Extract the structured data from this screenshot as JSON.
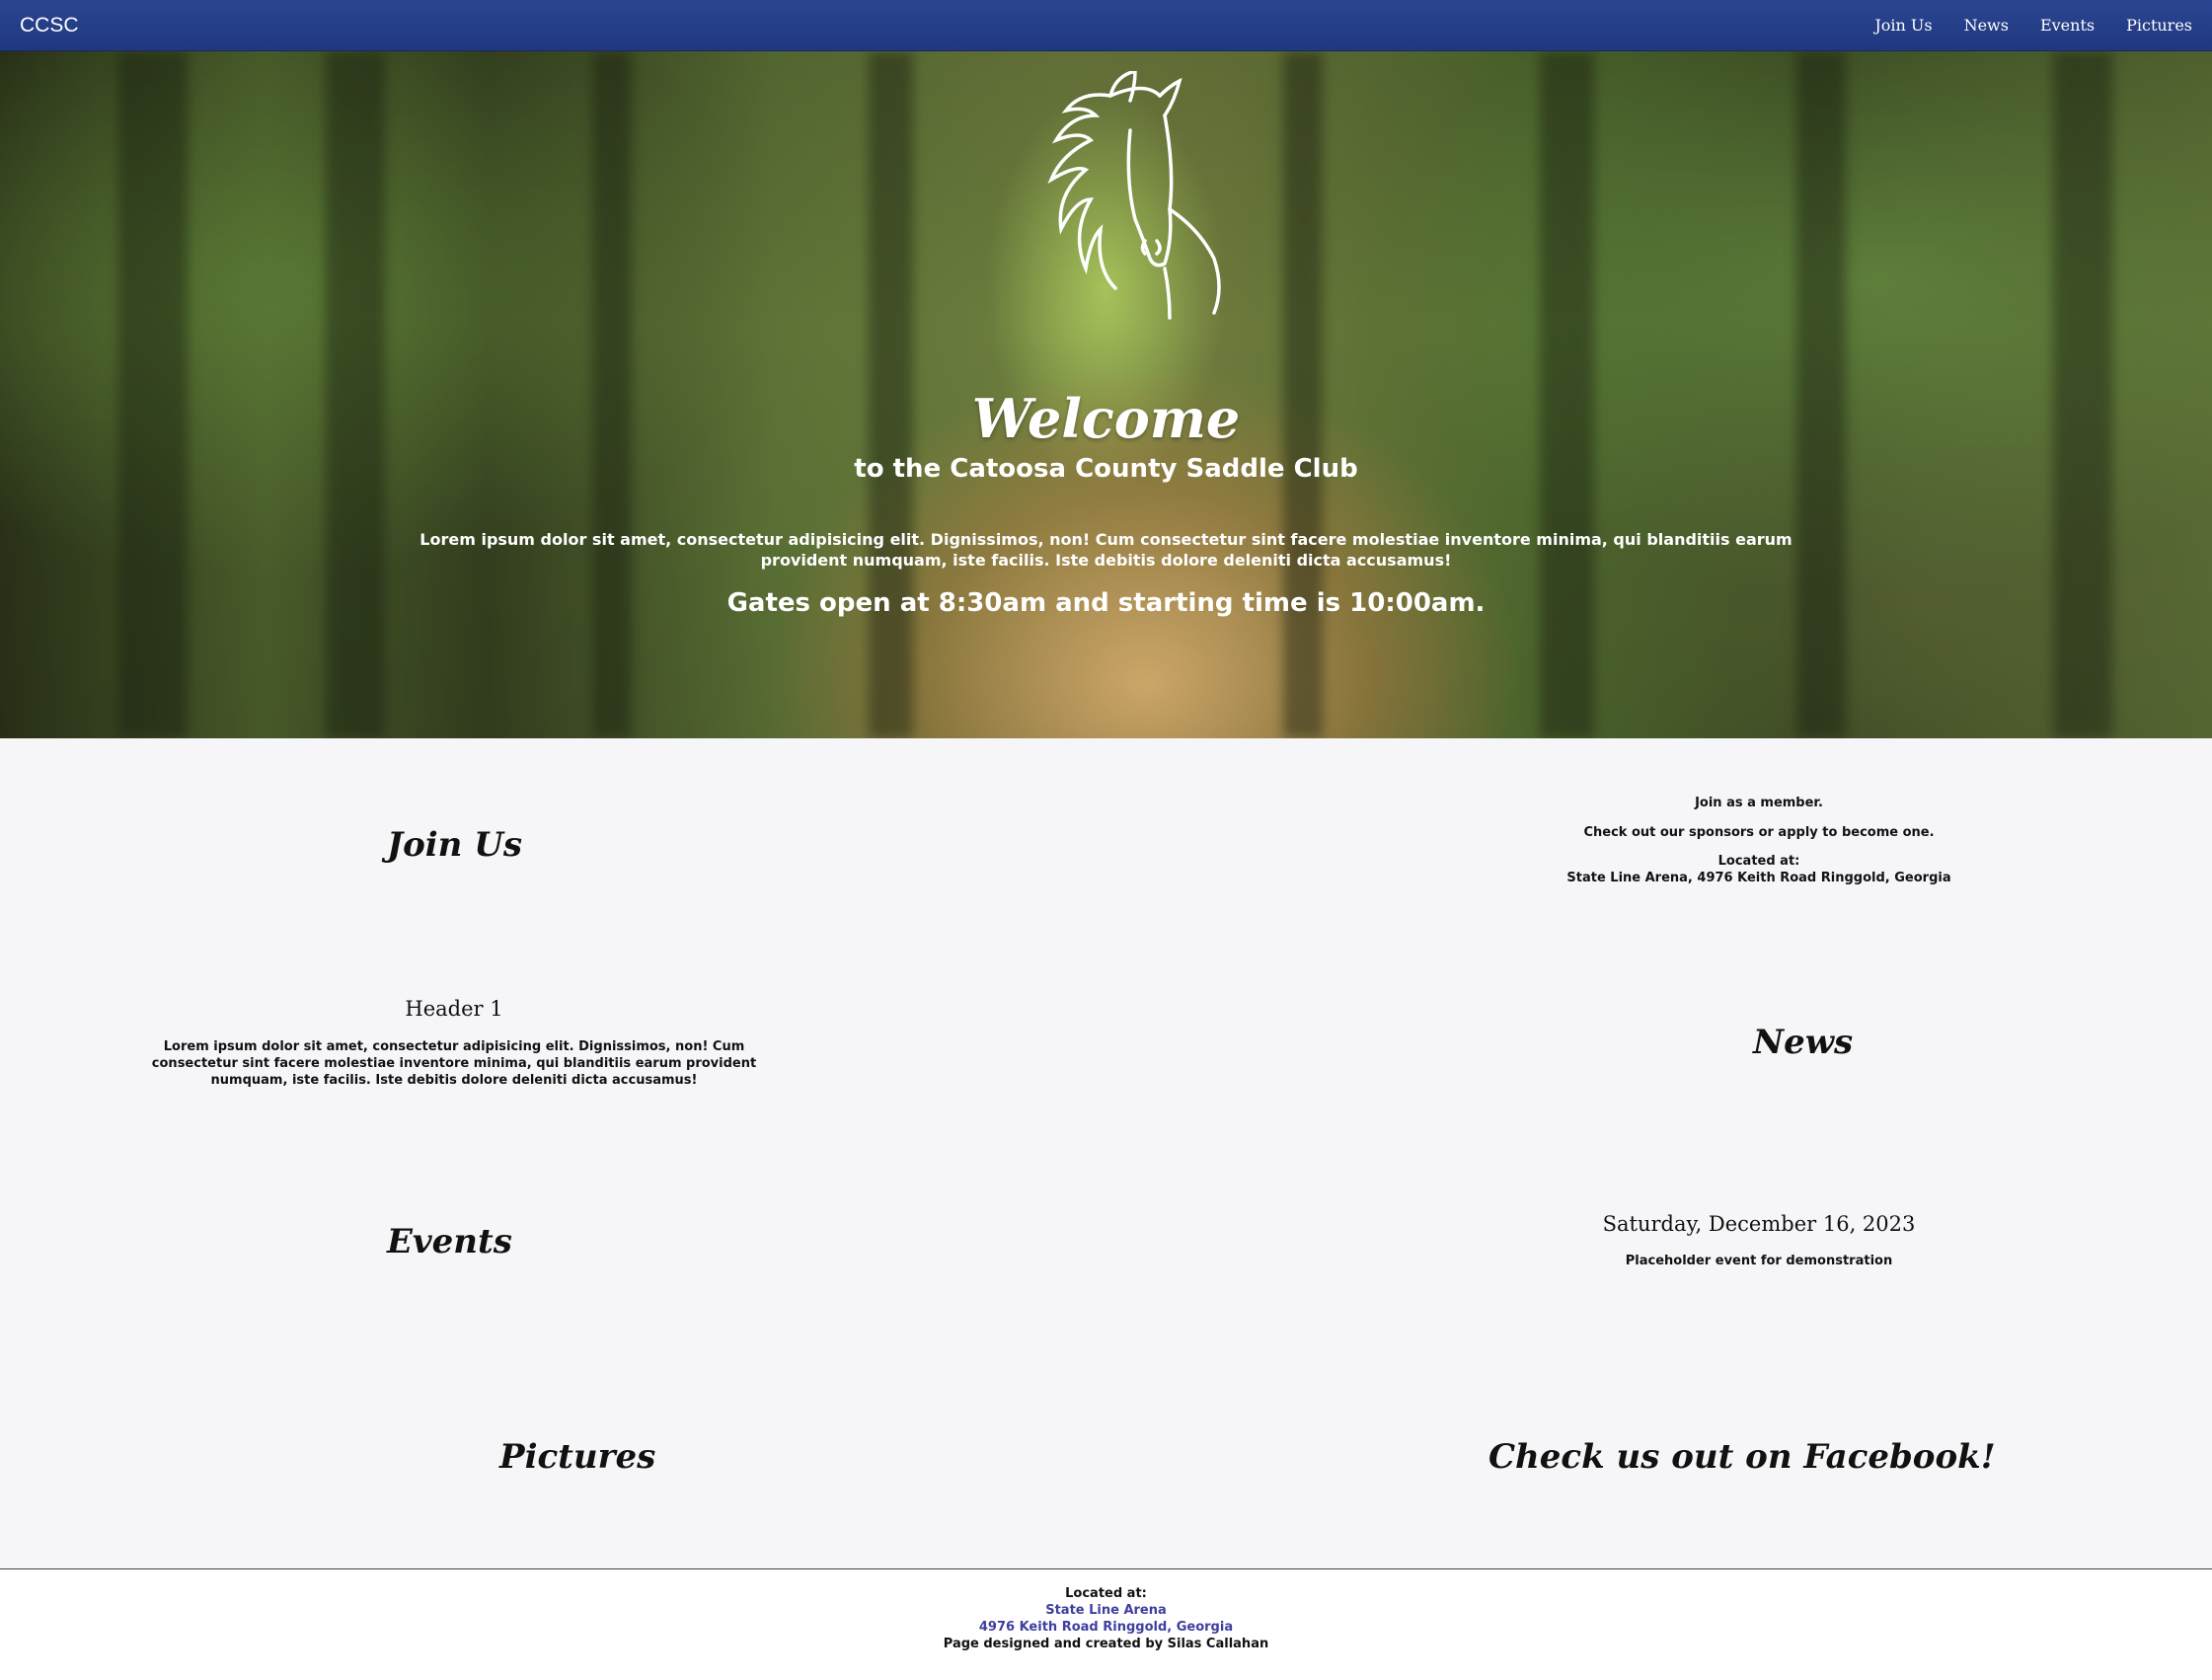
{
  "nav": {
    "brand": "CCSC",
    "links": [
      "Join Us",
      "News",
      "Events",
      "Pictures"
    ]
  },
  "hero": {
    "title": "Welcome",
    "subtitle": "to the Catoosa County Saddle Club",
    "paragraph": "Lorem ipsum dolor sit amet, consectetur adipisicing elit. Dignissimos, non! Cum consectetur sint facere molestiae inventore minima, qui blanditiis earum provident numquam, iste facilis. Iste debitis dolore deleniti dicta accusamus!",
    "gates": "Gates open at 8:30am and starting time is 10:00am."
  },
  "join": {
    "heading": "Join Us",
    "member": "Join as a member.",
    "sponsors": "Check out our sponsors or apply to become one.",
    "located_label": "Located at:",
    "address": "State Line Arena, 4976 Keith Road Ringgold, Georgia"
  },
  "news": {
    "header": "Header 1",
    "text": "Lorem ipsum dolor sit amet, consectetur adipisicing elit. Dignissimos, non! Cum consectetur sint facere molestiae inventore minima, qui blanditiis earum provident numquam, iste facilis. Iste debitis dolore deleniti dicta accusamus!",
    "heading": "News"
  },
  "events": {
    "heading": "Events",
    "date": "Saturday, December 16, 2023",
    "description": "Placeholder event for demonstration"
  },
  "pictures": {
    "heading": "Pictures",
    "facebook": "Check us out on Facebook!"
  },
  "footer": {
    "located_label": "Located at:",
    "venue": "State Line Arena",
    "address": "4976 Keith Road Ringgold, Georgia",
    "credit": "Page designed and created by Silas Callahan"
  }
}
